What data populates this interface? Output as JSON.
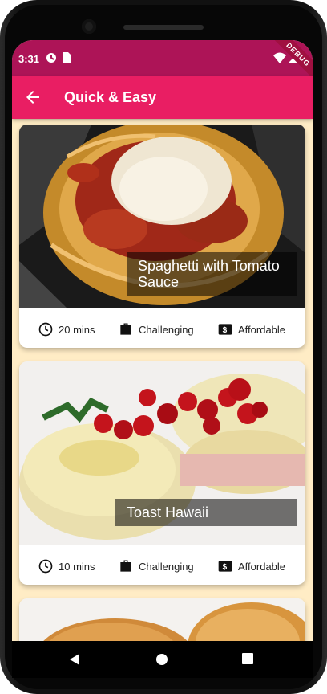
{
  "status": {
    "time": "3:31",
    "debug_banner": "DEBUG"
  },
  "appbar": {
    "title": "Quick & Easy"
  },
  "meals": [
    {
      "title": "Spaghetti with Tomato Sauce",
      "duration": "20 mins",
      "complexity": "Challenging",
      "affordability": "Affordable"
    },
    {
      "title": "Toast Hawaii",
      "duration": "10 mins",
      "complexity": "Challenging",
      "affordability": "Affordable"
    }
  ],
  "colors": {
    "primary": "#e91e63",
    "status_bar": "#ad1457",
    "background": "#ffecc5",
    "caption_bg": "rgba(0,0,0,0.54)"
  },
  "icons": {
    "back": "arrow-back-icon",
    "duration": "clock-icon",
    "complexity": "briefcase-icon",
    "affordability": "money-icon"
  }
}
